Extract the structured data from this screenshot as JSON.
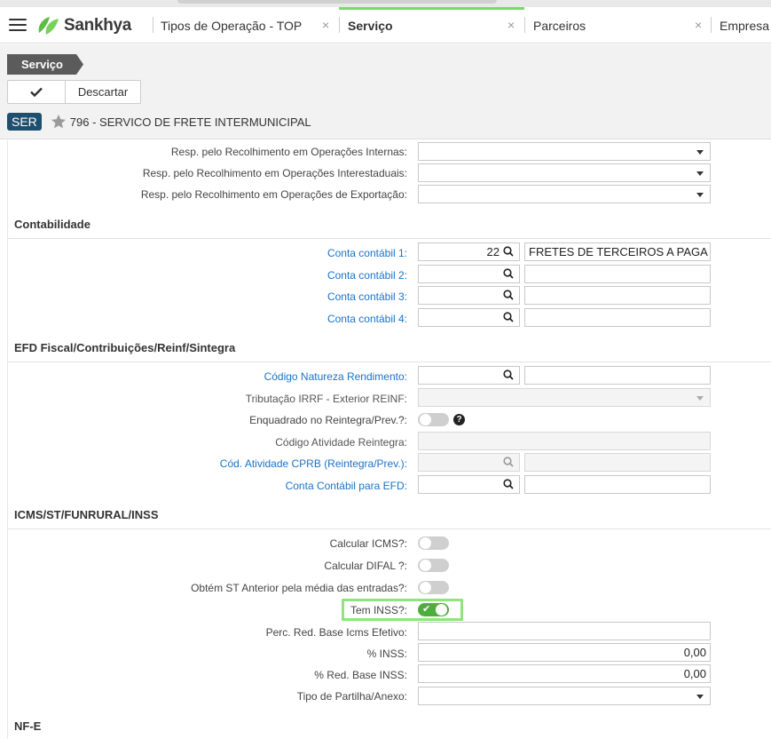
{
  "app": {
    "logo_text": "Sankhya"
  },
  "tabs": [
    {
      "label": "Tipos de Operação - TOP",
      "close": "×"
    },
    {
      "label": "Serviço",
      "close": "×"
    },
    {
      "label": "Parceiros",
      "close": "×"
    },
    {
      "label": "Empresa"
    }
  ],
  "header": {
    "breadcrumb": "Serviço",
    "discard_label": "Descartar",
    "badge": "SER",
    "record_title": "796 - SERVICO DE FRETE INTERMUNICIPAL"
  },
  "resp": {
    "internas": "Resp. pelo Recolhimento em Operações Internas:",
    "interestaduais": "Resp. pelo Recolhimento em Operações Interestaduais:",
    "exportacao": "Resp. pelo Recolhimento em Operações de Exportação:"
  },
  "contabilidade": {
    "title": "Contabilidade",
    "conta1_label": "Conta contábil 1:",
    "conta1_code": "22",
    "conta1_desc": "FRETES DE TERCEIROS A PAGAR",
    "conta2_label": "Conta contábil 2:",
    "conta3_label": "Conta contábil 3:",
    "conta4_label": "Conta contábil 4:"
  },
  "efd": {
    "title": "EFD Fiscal/Contribuições/Reinf/Sintegra",
    "natureza_label": "Código Natureza Rendimento:",
    "irrf_label": "Tributação IRRF - Exterior REINF:",
    "reintegra_label": "Enquadrado no Reintegra/Prev.?:",
    "reintegra_on": false,
    "help": "?",
    "cod_ativ_label": "Código Atividade Reintegra:",
    "cprb_label": "Cód. Atividade CPRB (Reintegra/Prev.):",
    "conta_efd_label": "Conta Contábil para EFD:"
  },
  "icms": {
    "title": "ICMS/ST/FUNRURAL/INSS",
    "calc_icms_label": "Calcular ICMS?:",
    "calc_icms_on": false,
    "calc_difal_label": "Calcular DIFAL ?:",
    "calc_difal_on": false,
    "st_anterior_label": "Obtém ST Anterior pela média das entradas?:",
    "st_anterior_on": false,
    "tem_inss_label": "Tem INSS?:",
    "tem_inss_on": true,
    "perc_red_label": "Perc. Red. Base Icms Efetivo:",
    "inss_label": "% INSS:",
    "inss_value": "0,00",
    "red_base_inss_label": "% Red. Base INSS:",
    "red_base_inss_value": "0,00",
    "partilha_label": "Tipo de Partilha/Anexo:"
  },
  "nfe": {
    "title": "NF-E"
  },
  "colors": {
    "accent": "#7ad96b",
    "badge": "#1e4f6e",
    "toggle_on": "#4caf3d",
    "link": "#1a73c7"
  }
}
